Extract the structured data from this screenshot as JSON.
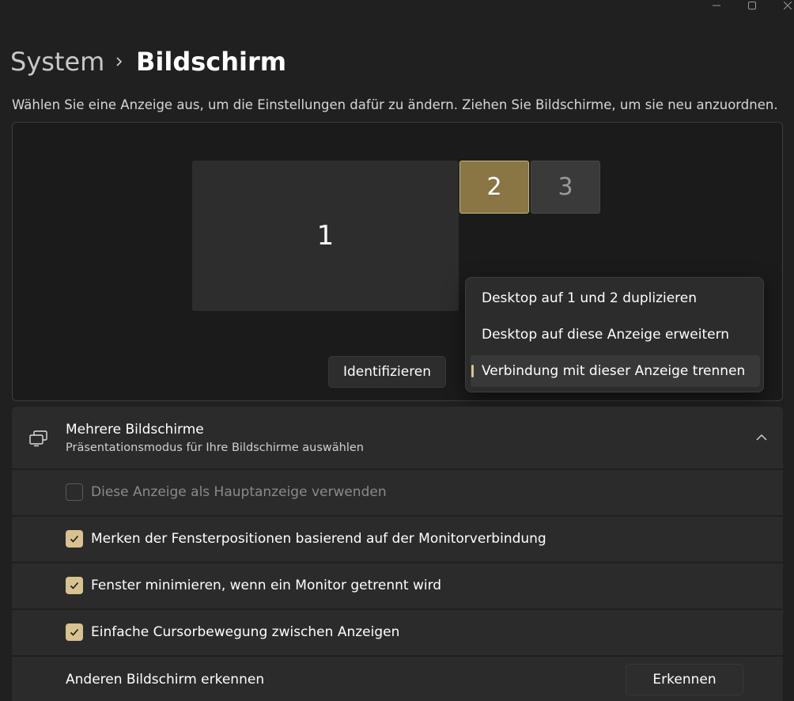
{
  "window": {
    "controls": [
      "minimize-icon",
      "maximize-icon",
      "close-icon"
    ]
  },
  "breadcrumb": {
    "root": "System",
    "current": "Bildschirm"
  },
  "description": "Wählen Sie eine Anzeige aus, um die Einstellungen dafür zu ändern. Ziehen Sie Bildschirme, um sie neu anzuordnen.",
  "arrangement": {
    "monitors": [
      {
        "label": "1",
        "state": "normal"
      },
      {
        "label": "2",
        "state": "selected"
      },
      {
        "label": "3",
        "state": "disconnected"
      }
    ],
    "identify_button": "Identifizieren"
  },
  "context_menu": {
    "items": [
      {
        "label": "Desktop auf 1 und 2 duplizieren",
        "selected": false
      },
      {
        "label": "Desktop auf diese Anzeige erweitern",
        "selected": false
      },
      {
        "label": "Verbindung mit dieser Anzeige trennen",
        "selected": true
      }
    ]
  },
  "multiple_displays": {
    "title": "Mehrere Bildschirme",
    "subtitle": "Präsentationsmodus für Ihre Bildschirme auswählen",
    "expanded": true,
    "options": [
      {
        "label": "Diese Anzeige als Hauptanzeige verwenden",
        "checked": false,
        "enabled": false
      },
      {
        "label": "Merken der Fensterpositionen basierend auf der Monitorverbindung",
        "checked": true,
        "enabled": true
      },
      {
        "label": "Fenster minimieren, wenn ein Monitor getrennt wird",
        "checked": true,
        "enabled": true
      },
      {
        "label": "Einfache Cursorbewegung zwischen Anzeigen",
        "checked": true,
        "enabled": true
      }
    ],
    "detect": {
      "label": "Anderen Bildschirm erkennen",
      "button": "Erkennen"
    }
  },
  "colors": {
    "accent": "#d7c290",
    "selected_monitor": "#8a7545",
    "background": "#202020",
    "card": "#2b2b2b"
  }
}
